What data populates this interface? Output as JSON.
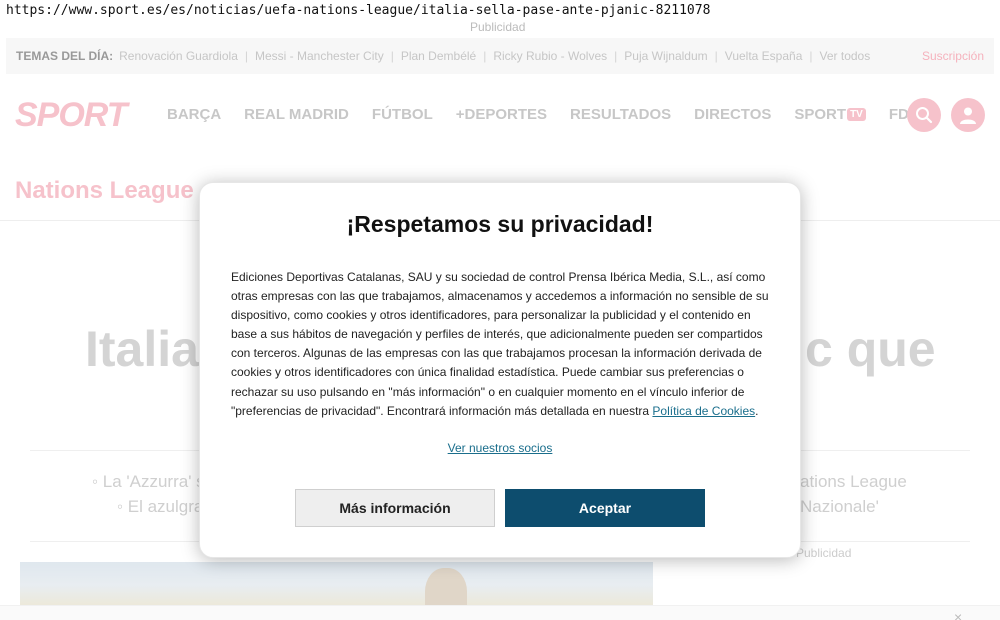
{
  "browser": {
    "url": "https://www.sport.es/es/noticias/uefa-nations-league/italia-sella-pase-ante-pjanic-8211078"
  },
  "ad_label_top": "Publicidad",
  "topics_bar": {
    "label": "TEMAS DEL DÍA:",
    "items": [
      "Renovación Guardiola",
      "Messi - Manchester City",
      "Plan Dembélé",
      "Ricky Rubio - Wolves",
      "Puja Wijnaldum",
      "Vuelta España",
      "Ver todos"
    ],
    "subscribe": "Suscripción"
  },
  "nav": {
    "logo": "SPORT",
    "items": [
      "BARÇA",
      "REAL MADRID",
      "FÚTBOL",
      "+DEPORTES",
      "RESULTADOS",
      "DIRECTOS",
      "SPORT",
      "FDJ"
    ],
    "tv_badge": "TV",
    "search_icon": "search-icon",
    "user_icon": "user-icon",
    "accent_color": "#f6c2cb"
  },
  "section": {
    "title": "Nations League"
  },
  "article": {
    "headline_left": "Italia",
    "headline_right": "c que",
    "sub_left_1": "◦ La 'Azzurra' s",
    "sub_left_2": "◦ El azulgra",
    "sub_right_1": "ations League",
    "sub_right_2": "Nazionale'",
    "ad_side": "Publicidad"
  },
  "consent_modal": {
    "title": "¡Respetamos su privacidad!",
    "body": "Ediciones Deportivas Catalanas, SAU y su sociedad de control Prensa Ibérica Media, S.L., así como otras empresas con las que trabajamos, almacenamos y accedemos a información no sensible de su dispositivo, como cookies y otros identificadores, para personalizar la publicidad y el contenido en base a sus hábitos de navegación y perfiles de interés, que adicionalmente pueden ser compartidos con terceros. Algunas de las empresas con las que trabajamos procesan la información derivada de cookies y otros identificadores con única finalidad estadística. Puede cambiar sus preferencias o rechazar su uso pulsando en \"más información\" o en cualquier momento en el vínculo inferior de \"preferencias de privacidad\". Encontrará información más detallada en nuestra ",
    "cookie_link": "Política de Cookies",
    "body_end": ".",
    "partners_link": "Ver nuestros socios",
    "more_button": "Más información",
    "accept_button": "Aceptar",
    "accept_color": "#0d4d6e",
    "link_color": "#1a6e8c"
  },
  "bottom_close": "×"
}
